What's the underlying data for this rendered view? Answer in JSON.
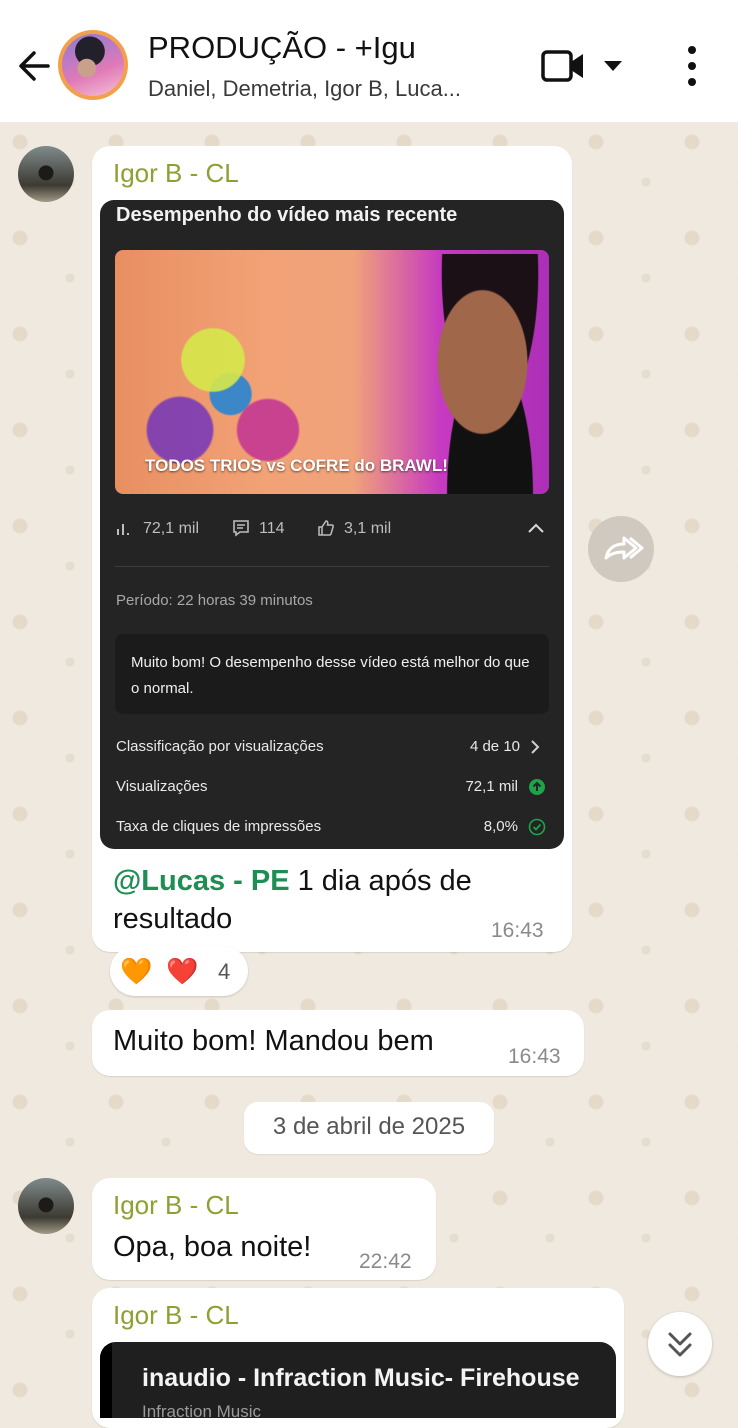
{
  "header": {
    "title": "PRODUÇÃO - +Igu",
    "participants": "Daniel, Demetria, Igor B, Luca..."
  },
  "messages": {
    "post": {
      "sender": "Igor B - CL",
      "card": {
        "title": "Desempenho do vídeo mais recente",
        "thumbnail_caption": "TODOS TRIOS vs COFRE do BRAWL!",
        "views_stat": "72,1 mil",
        "comments_stat": "114",
        "likes_stat": "3,1 mil",
        "period": "Período: 22 horas 39 minutos",
        "note": "Muito bom! O desempenho desse vídeo está melhor do que o normal.",
        "rows": [
          {
            "label": "Classificação por visualizações",
            "value": "4 de 10"
          },
          {
            "label": "Visualizações",
            "value": "72,1 mil"
          },
          {
            "label": "Taxa de cliques de impressões",
            "value": "8,0%"
          }
        ]
      },
      "mention": "@Lucas - PE",
      "text_after_mention": " 1 dia após de resultado",
      "time": "16:43",
      "reactions": {
        "emojis": [
          "🧡",
          "❤️"
        ],
        "count": "4"
      }
    },
    "reply": {
      "text": "Muito bom! Mandou bem",
      "time": "16:43"
    },
    "date_separator": "3 de abril de 2025",
    "greeting": {
      "sender": "Igor B - CL",
      "text": "Opa, boa noite!",
      "time": "22:42"
    },
    "link_post": {
      "sender": "Igor B - CL",
      "link_title": "inaudio - Infraction Music- Firehouse",
      "link_subtitle": "Infraction Music"
    }
  },
  "colors": {
    "sender_name": "#8fa032",
    "mention": "#1e8e55",
    "header_bg": "#ffffff",
    "chat_bg": "#efe9df",
    "positive_icon": "#1fa34a"
  },
  "icons": [
    "back-arrow-icon",
    "video-call-icon",
    "dropdown-icon",
    "more-vert-icon",
    "views-icon",
    "comments-icon",
    "likes-icon",
    "chevron-up-icon",
    "chevron-right-icon",
    "arrow-up-circle-icon",
    "check-circle-icon",
    "forward-icon",
    "double-chevron-down-icon"
  ]
}
